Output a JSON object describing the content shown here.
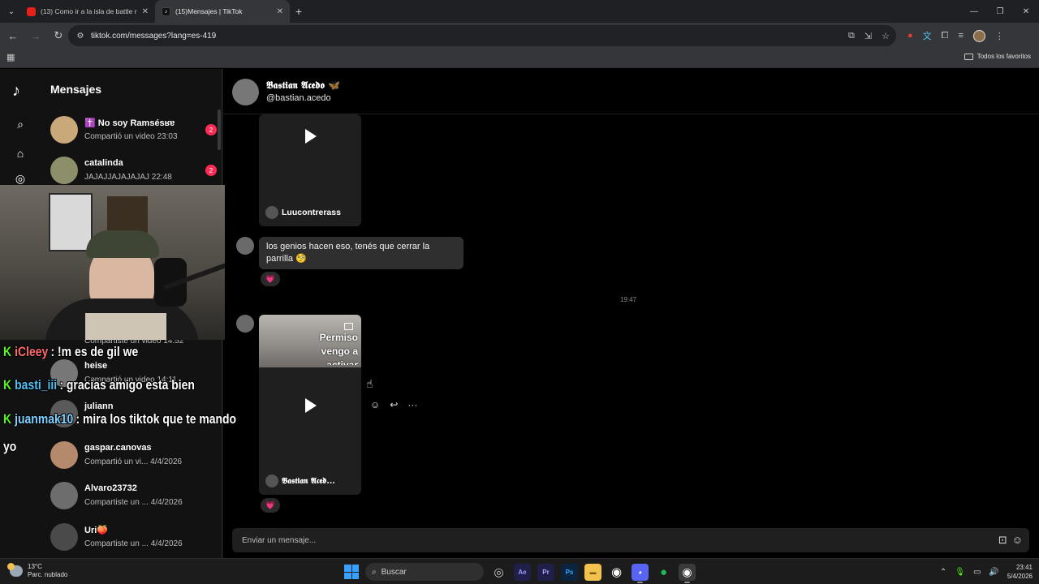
{
  "browser": {
    "tabs": [
      {
        "title": "(13) Como ir a la isla de battle roya",
        "favicon": "youtube-icon",
        "active": false
      },
      {
        "title": "(15)Mensajes | TikTok",
        "favicon": "tiktok-icon",
        "active": true
      }
    ],
    "url": "tiktok.com/messages?lang=es-419",
    "bookmarks_all_label": "Todos los favoritos"
  },
  "sidebar": {
    "title": "Mensajes",
    "conversations": [
      {
        "name": "✝️ No soy Ramsésʁɐ",
        "preview": "Compartió un video 23:03",
        "badge": "2"
      },
      {
        "name": "catalinda",
        "preview": "JAJAJJAJAJAJAJ 22:48",
        "badge": "2"
      },
      {
        "name": "",
        "preview": "Compartiste un video 14:52",
        "badge": ""
      },
      {
        "name": "heise",
        "preview": "Compartió un video 14:11",
        "badge": ""
      },
      {
        "name": "juliann",
        "preview": "",
        "badge": ""
      },
      {
        "name": "gaspar.canovas",
        "preview": "Compartió un vi...   4/4/2026",
        "badge": ""
      },
      {
        "name": "Alvaro23732",
        "preview": "Compartiste un ...   4/4/2026",
        "badge": ""
      },
      {
        "name": "Uri🍑",
        "preview": "Compartiste un ...   4/4/2026",
        "badge": ""
      }
    ]
  },
  "chat": {
    "contact_name": "𝕭𝖆𝖘𝖙𝖎𝖆𝖓 𝕬𝖈𝖊𝖉𝖔 🦋",
    "contact_handle": "@bastian.acedo",
    "video1_author": "Luucontrerass",
    "message_text": "los genios hacen eso, tenés que cerrar la parrilla 🧐",
    "reaction": "💗",
    "timestamp": "19:47",
    "video2_overlay_text": "Permiso vengo a activar",
    "video2_author": "𝕭𝖆𝖘𝖙𝖎𝖆𝖓 𝕬𝖈𝖊𝖉...",
    "composer_placeholder": "Enviar un mensaje..."
  },
  "stream_chat": [
    {
      "badge": "K",
      "user": "iCleey",
      "user_color": "#ff6b6b",
      "message": ": !m es de gil we"
    },
    {
      "badge": "K",
      "user": "basti_iii",
      "user_color": "#4fc3f7",
      "message": ": gracias amigo esta bien"
    },
    {
      "badge": "K",
      "user": "juanmak10",
      "user_color": "#7fd0ff",
      "message": ": mira los tiktok que te mando"
    },
    {
      "badge": "",
      "user": "",
      "user_color": "#ffffff",
      "message": "yo"
    }
  ],
  "taskbar": {
    "weather_temp": "13°C",
    "weather_desc": "Parc. nublado",
    "search_placeholder": "Buscar",
    "time": "23:41",
    "date": "5/4/2026"
  },
  "colors": {
    "accent": "#fe2c55",
    "kick_green": "#53fc18",
    "bg": "#000000"
  }
}
